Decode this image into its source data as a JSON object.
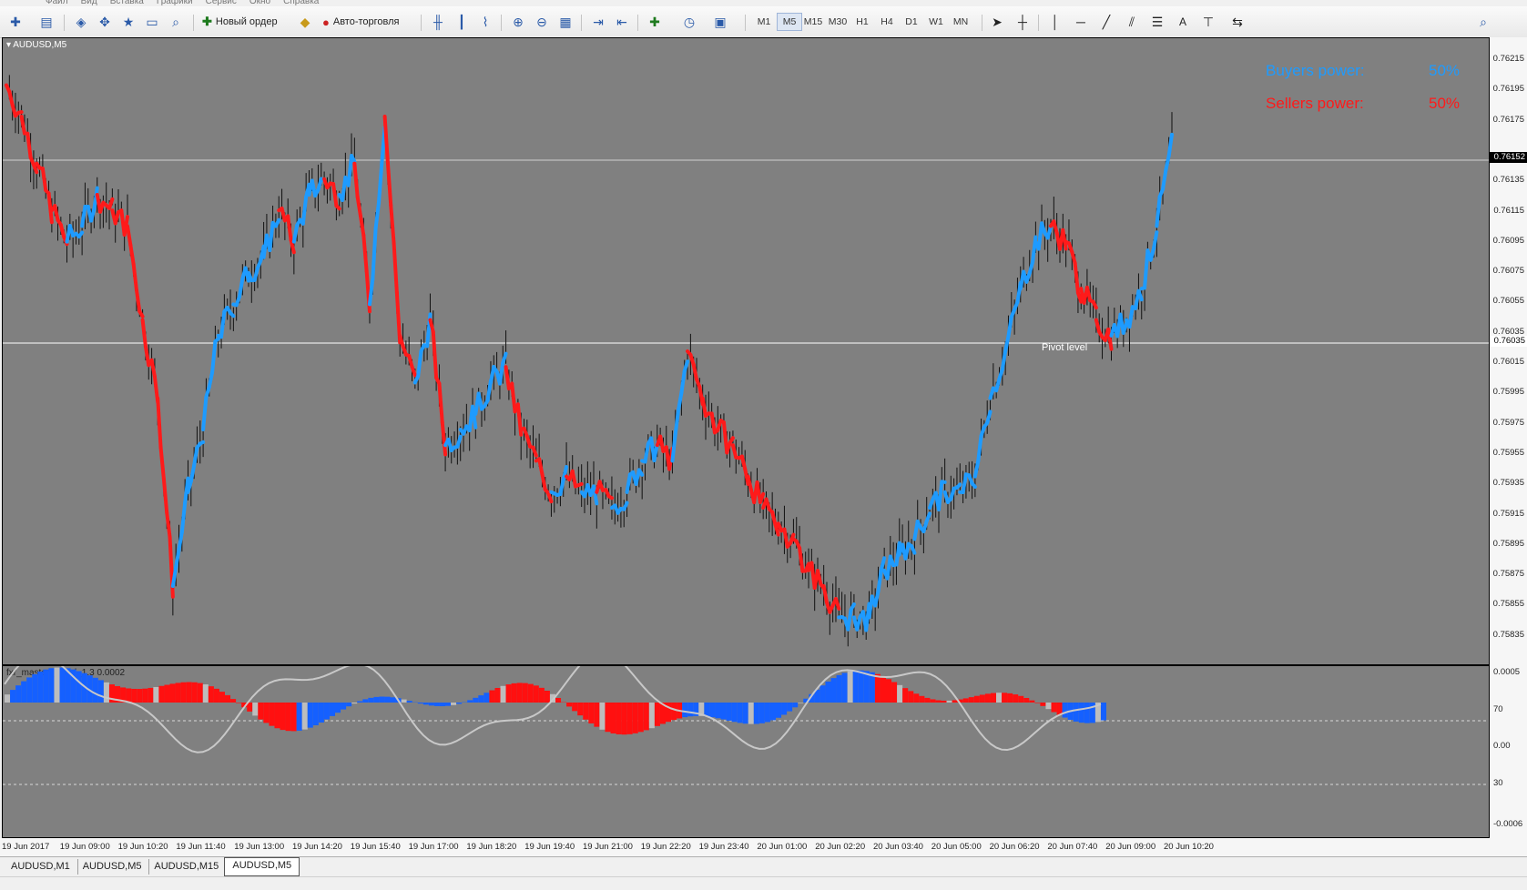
{
  "menu": [
    "Файл",
    "Вид",
    "Вставка",
    "Графики",
    "Сервис",
    "Окно",
    "Справка"
  ],
  "toolbar": {
    "new_order": "Новый ордер",
    "auto_trading": "Авто-торговля",
    "timeframes": [
      "M1",
      "M5",
      "M15",
      "M30",
      "H1",
      "H4",
      "D1",
      "W1",
      "MN"
    ],
    "active_timeframe": "M5",
    "text_tool": "A"
  },
  "main_chart": {
    "symbol_label": "AUDUSD,M5",
    "buyers_label": "Buyers power:",
    "buyers_value": "50%",
    "sellers_label": "Sellers power:",
    "sellers_value": "50%",
    "pivot_label": "Pivot level",
    "current_price": "0.76152",
    "pivot_price": "0.76035",
    "buyers_color": "#1e9bff",
    "sellers_color": "#ff1a1a"
  },
  "price_axis": [
    "0.76215",
    "0.76195",
    "0.76175",
    "0.76152",
    "0.76135",
    "0.76115",
    "0.76095",
    "0.76075",
    "0.76055",
    "0.76035",
    "0.76015",
    "0.75995",
    "0.75975",
    "0.75955",
    "0.75935",
    "0.75915",
    "0.75895",
    "0.75875",
    "0.75855",
    "0.75835"
  ],
  "indicator": {
    "name": "fxr_master_macd_1.3 0.0002",
    "axis_labels": [
      "0.0005",
      "70",
      "0.00",
      "30",
      "-0.0006"
    ]
  },
  "time_axis": [
    "19 Jun 2017",
    "19 Jun 09:00",
    "19 Jun 10:20",
    "19 Jun 11:40",
    "19 Jun 13:00",
    "19 Jun 14:20",
    "19 Jun 15:40",
    "19 Jun 17:00",
    "19 Jun 18:20",
    "19 Jun 19:40",
    "19 Jun 21:00",
    "19 Jun 22:20",
    "19 Jun 23:40",
    "20 Jun 01:00",
    "20 Jun 02:20",
    "20 Jun 03:40",
    "20 Jun 05:00",
    "20 Jun 06:20",
    "20 Jun 07:40",
    "20 Jun 09:00",
    "20 Jun 10:20"
  ],
  "tabs": [
    "AUDUSD,M1",
    "AUDUSD,M5",
    "AUDUSD,M15",
    "AUDUSD,M5"
  ],
  "active_tab": 3,
  "chart_data": {
    "type": "line",
    "symbol": "AUDUSD",
    "timeframe": "M5",
    "ylim": [
      0.7583,
      0.7623
    ],
    "series": [
      {
        "values": [
          0.762,
          0.7618,
          0.7615,
          0.7612,
          0.761,
          0.7611,
          0.7613,
          0.7612,
          0.7611,
          0.7605,
          0.76,
          0.7588,
          0.7594,
          0.7598,
          0.7604,
          0.7606,
          0.7608,
          0.7609,
          0.7612,
          0.761,
          0.7613,
          0.7614,
          0.7613,
          0.7615,
          0.7606,
          0.7618,
          0.7604,
          0.7601,
          0.7605,
          0.7597,
          0.7598,
          0.7599,
          0.7601,
          0.7602,
          0.7598,
          0.7596,
          0.7594,
          0.7595,
          0.7594,
          0.7594,
          0.7593,
          0.7594,
          0.7596,
          0.7597,
          0.7596,
          0.7603,
          0.76,
          0.7598,
          0.7597,
          0.7595,
          0.7593,
          0.7592,
          0.7591,
          0.7589,
          0.7588,
          0.7586,
          0.7586,
          0.7586,
          0.7589,
          0.759,
          0.7591,
          0.7593,
          0.7594,
          0.7594,
          0.7595,
          0.76,
          0.7603,
          0.7607,
          0.761,
          0.7611,
          0.761,
          0.7607,
          0.7605,
          0.7604,
          0.7605,
          0.7607,
          0.7611,
          0.7616
        ]
      }
    ]
  }
}
